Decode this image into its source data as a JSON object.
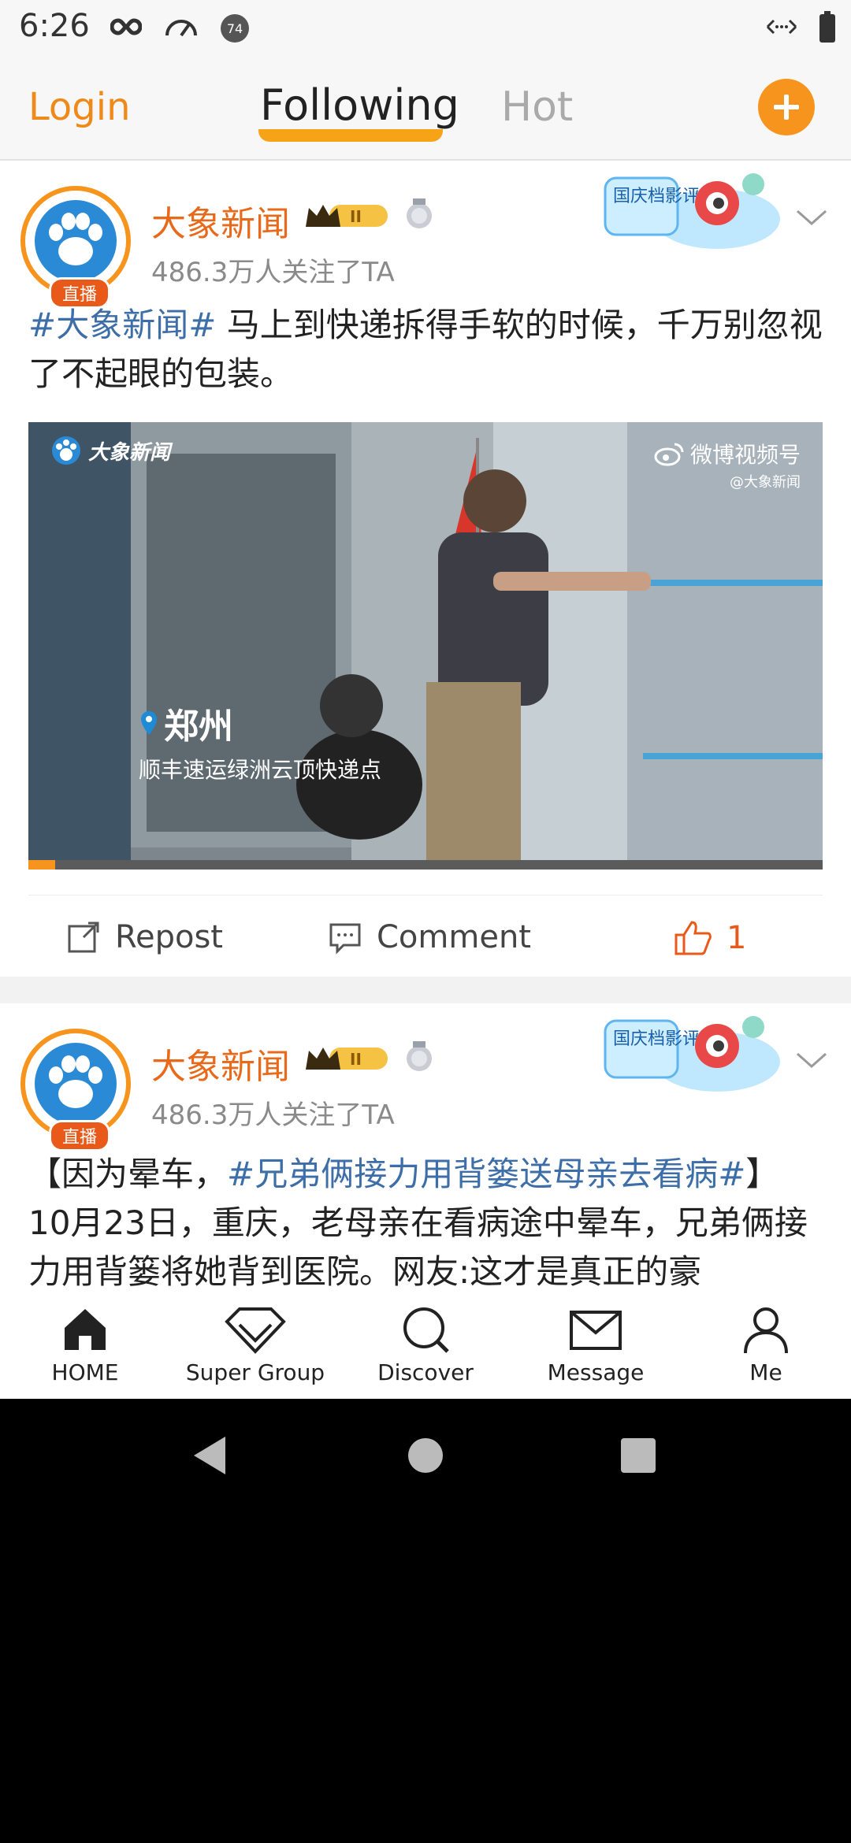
{
  "status_bar": {
    "time": "6:26",
    "notification_badge": "74"
  },
  "header": {
    "login": "Login",
    "tabs": [
      "Following",
      "Hot"
    ],
    "active_tab": "Following"
  },
  "posts": [
    {
      "author": "大象新闻",
      "level": "II",
      "followers": "486.3万人关注了TA",
      "live_badge": "直播",
      "event_badge": "国庆档影评达人",
      "text_hashtag": "#大象新闻#",
      "text_body": " 马上到快递拆得手软的时候，千万别忽视了不起眼的包装。",
      "video": {
        "watermark": "大象新闻",
        "channel": "微博视频号",
        "channel_handle": "@大象新闻",
        "location": "郑州",
        "caption": "顺丰速运绿洲云顶快递点"
      },
      "actions": {
        "repost": "Repost",
        "comment": "Comment",
        "likes": "1"
      }
    },
    {
      "author": "大象新闻",
      "level": "II",
      "followers": "486.3万人关注了TA",
      "live_badge": "直播",
      "event_badge": "国庆档影评达人",
      "text_prefix": "【因为晕车，",
      "text_hashtag": "#兄弟俩接力用背篓送母亲去看病#",
      "text_suffix": "】",
      "text_body": "10月23日，重庆，老母亲在看病途中晕车，兄弟俩接力用背篓将她背到医院。网友:这才是真正的豪"
    }
  ],
  "bottom_nav": [
    {
      "label": "HOME",
      "icon": "home-icon"
    },
    {
      "label": "Super Group",
      "icon": "diamond-icon"
    },
    {
      "label": "Discover",
      "icon": "search-icon"
    },
    {
      "label": "Message",
      "icon": "envelope-icon"
    },
    {
      "label": "Me",
      "icon": "person-icon"
    }
  ],
  "colors": {
    "accent": "#f7941e",
    "hashtag": "#3d6ea8",
    "author": "#e8691a"
  }
}
